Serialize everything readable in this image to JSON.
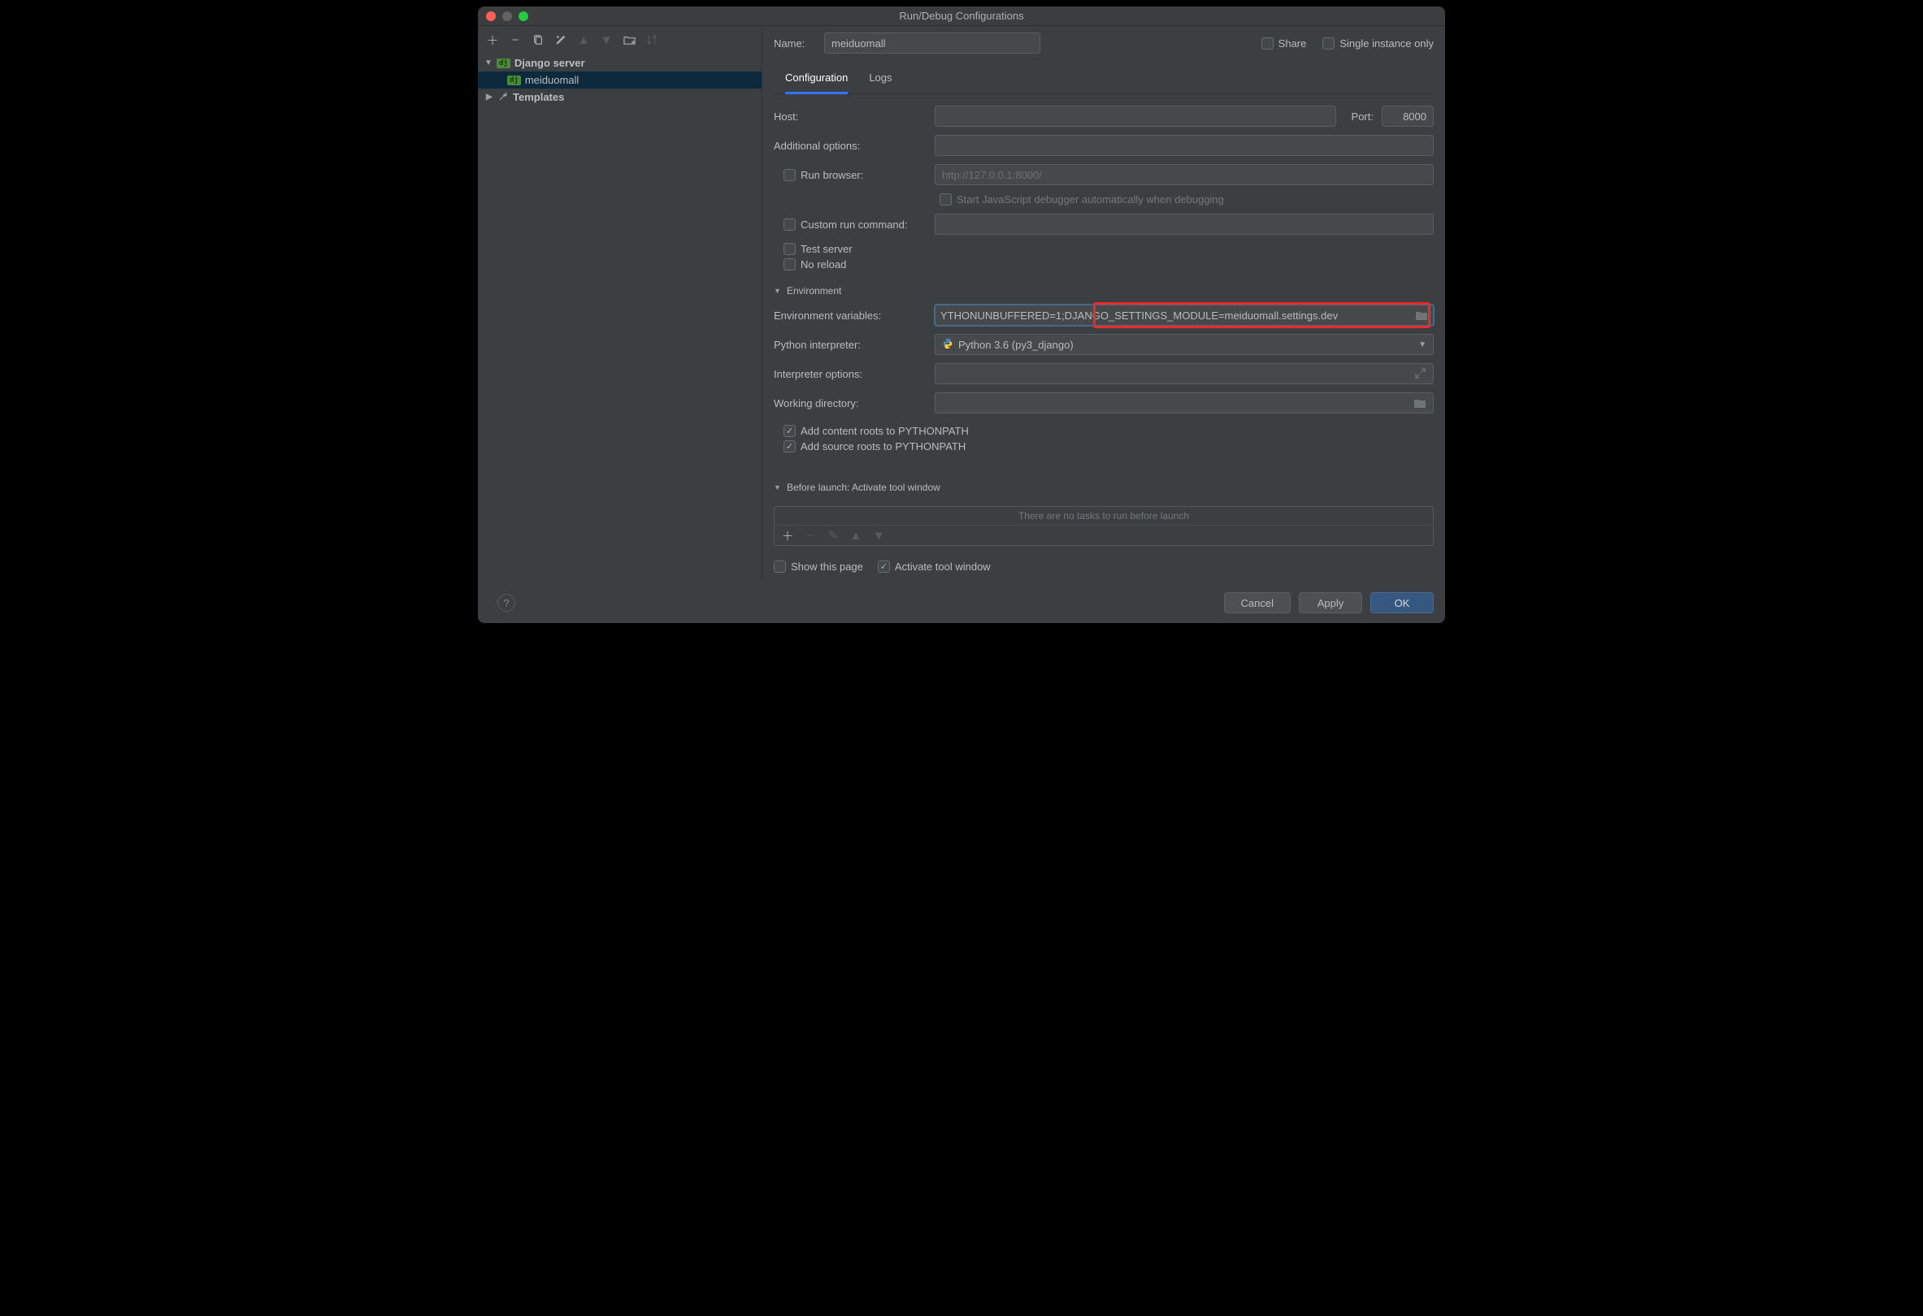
{
  "window_title": "Run/Debug Configurations",
  "sidebar": {
    "django_server": "Django server",
    "config_name": "meiduomall",
    "templates": "Templates"
  },
  "header": {
    "name_label": "Name:",
    "name_value": "meiduomall",
    "share": "Share",
    "single_instance": "Single instance only"
  },
  "tabs": {
    "configuration": "Configuration",
    "logs": "Logs"
  },
  "form": {
    "host": "Host:",
    "port": "Port:",
    "port_value": "8000",
    "additional_options": "Additional options:",
    "run_browser": "Run browser:",
    "run_browser_placeholder": "http://127.0.0.1:8000/",
    "start_js_debugger": "Start JavaScript debugger automatically when debugging",
    "custom_run": "Custom run command:",
    "test_server": "Test server",
    "no_reload": "No reload",
    "environment_section": "Environment",
    "env_vars_label": "Environment variables:",
    "env_vars_value": "YTHONUNBUFFERED=1;DJANGO_SETTINGS_MODULE=meiduomall.settings.dev",
    "python_interp": "Python interpreter:",
    "python_interp_value": "Python 3.6 (py3_django)",
    "interp_options": "Interpreter options:",
    "working_dir": "Working directory:",
    "add_content_roots": "Add content roots to PYTHONPATH",
    "add_source_roots": "Add source roots to PYTHONPATH",
    "before_launch_section": "Before launch: Activate tool window",
    "no_tasks": "There are no tasks to run before launch",
    "show_page": "Show this page",
    "activate_tool": "Activate tool window"
  },
  "footer": {
    "cancel": "Cancel",
    "apply": "Apply",
    "ok": "OK"
  }
}
